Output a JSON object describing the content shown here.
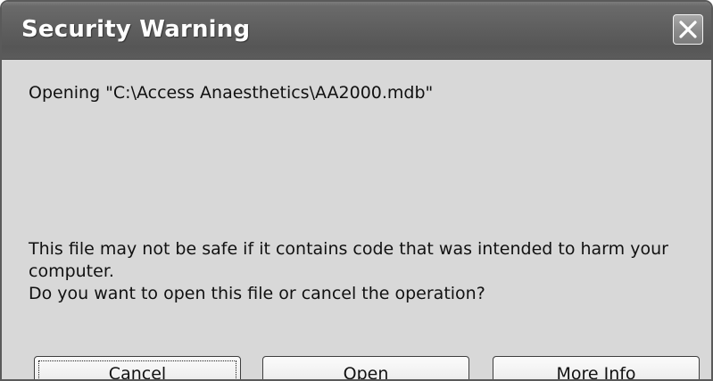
{
  "window": {
    "title": "Security Warning"
  },
  "message": {
    "opening": "Opening \"C:\\Access Anaesthetics\\AA2000.mdb\"",
    "warning_line1": "This file may not be safe if it contains code that was intended to harm your",
    "warning_line2": "computer.",
    "question": "Do you want to open this file or cancel the operation?"
  },
  "buttons": {
    "cancel": {
      "mnemonic": "C",
      "rest": "ancel"
    },
    "open": {
      "mnemonic": "O",
      "rest": "pen"
    },
    "more_info": {
      "mnemonic": "M",
      "rest": "ore Info"
    }
  },
  "icons": {
    "close": "close-icon"
  },
  "colors": {
    "titlebar": "#5f5f5f",
    "dialog_face": "#d8d8d8",
    "title_text": "#ffffff"
  }
}
